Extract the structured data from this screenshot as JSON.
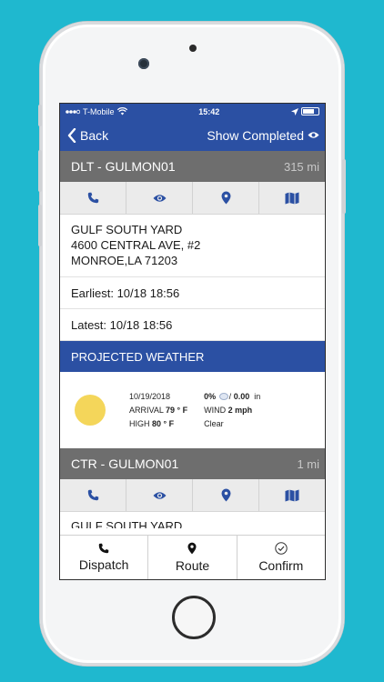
{
  "status": {
    "carrier": "T-Mobile",
    "time": "15:42"
  },
  "nav": {
    "back_label": "Back",
    "show_completed_label": "Show Completed"
  },
  "stops": [
    {
      "title": "DLT - GULMON01",
      "distance": "315 mi",
      "address": [
        "GULF SOUTH YARD",
        "4600 CENTRAL AVE, #2",
        "MONROE,LA 71203"
      ],
      "earliest": "Earliest: 10/18 18:56",
      "latest": "Latest: 10/18 18:56"
    },
    {
      "title": "CTR - GULMON01",
      "distance": "1 mi",
      "address_partial": "GULF SOUTH YARD"
    }
  ],
  "weather": {
    "header": "PROJECTED WEATHER",
    "date": "10/19/2018",
    "arrival_label": "ARRIVAL",
    "arrival_value": "79 ° F",
    "high_label": "HIGH",
    "high_value": "80 ° F",
    "precip_pct": "0%",
    "precip_amount": "0.00",
    "precip_unit": "in",
    "wind_label": "WIND",
    "wind_value": "2 mph",
    "condition": "Clear"
  },
  "tabs": [
    {
      "label": "Dispatch",
      "icon": "phone-icon"
    },
    {
      "label": "Route",
      "icon": "map-pin-icon"
    },
    {
      "label": "Confirm",
      "icon": "check-circle-icon"
    }
  ],
  "colors": {
    "brand_blue": "#2b50a3",
    "header_gray": "#6e6e6e",
    "icon_blue": "#2b50a3",
    "background": "#1fb8cf"
  }
}
